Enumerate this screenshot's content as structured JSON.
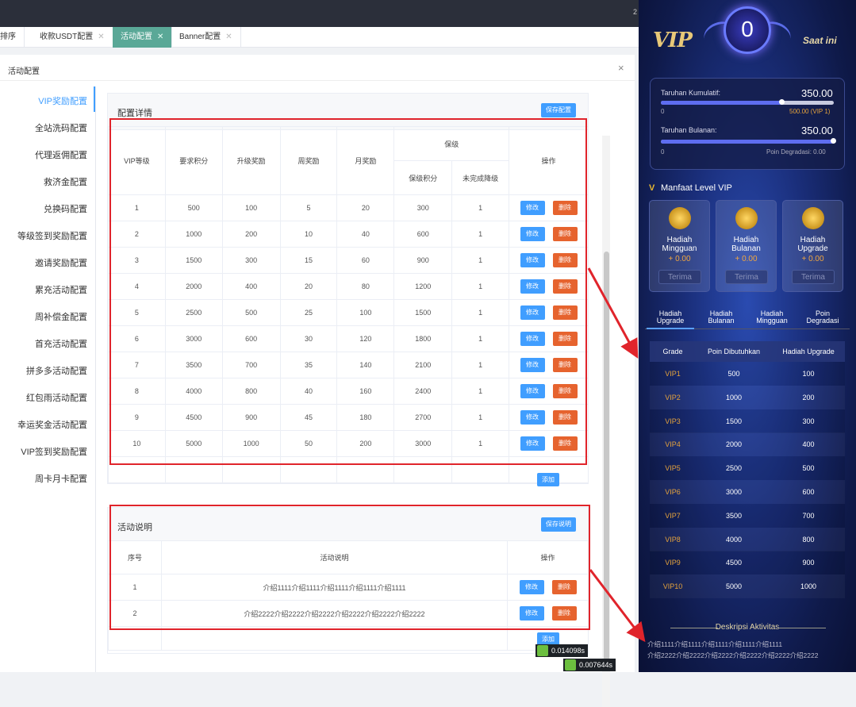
{
  "tabs": [
    {
      "label": "排序",
      "active": false
    },
    {
      "label": "收款USDT配置",
      "active": false
    },
    {
      "label": "活动配置",
      "active": true
    },
    {
      "label": "Banner配置",
      "active": false
    }
  ],
  "top_number": "2",
  "dialog": {
    "title": "活动配置",
    "close": "×"
  },
  "menu": [
    "VIP奖励配置",
    "全站洗码配置",
    "代理返佣配置",
    "救济金配置",
    "兑换码配置",
    "等级签到奖励配置",
    "邀请奖励配置",
    "累充活动配置",
    "周补偿金配置",
    "首充活动配置",
    "拼多多活动配置",
    "红包雨活动配置",
    "幸运奖金活动配置",
    "VIP签到奖励配置",
    "周卡月卡配置"
  ],
  "config_panel": {
    "title": "配置详情",
    "save_label": "保存配置",
    "headers": {
      "vip": "VIP等级",
      "points": "要求积分",
      "upgrade": "升级奖励",
      "weekly": "周奖励",
      "monthly": "月奖励",
      "keep": "保级",
      "keep_points": "保级积分",
      "not_done": "未完成降级",
      "ops": "操作"
    },
    "rows": [
      [
        "1",
        "500",
        "100",
        "5",
        "20",
        "300",
        "1"
      ],
      [
        "2",
        "1000",
        "200",
        "10",
        "40",
        "600",
        "1"
      ],
      [
        "3",
        "1500",
        "300",
        "15",
        "60",
        "900",
        "1"
      ],
      [
        "4",
        "2000",
        "400",
        "20",
        "80",
        "1200",
        "1"
      ],
      [
        "5",
        "2500",
        "500",
        "25",
        "100",
        "1500",
        "1"
      ],
      [
        "6",
        "3000",
        "600",
        "30",
        "120",
        "1800",
        "1"
      ],
      [
        "7",
        "3500",
        "700",
        "35",
        "140",
        "2100",
        "1"
      ],
      [
        "8",
        "4000",
        "800",
        "40",
        "160",
        "2400",
        "1"
      ],
      [
        "9",
        "4500",
        "900",
        "45",
        "180",
        "2700",
        "1"
      ],
      [
        "10",
        "5000",
        "1000",
        "50",
        "200",
        "3000",
        "1"
      ]
    ],
    "edit_label": "修改",
    "delete_label": "删除",
    "add_label": "添加"
  },
  "desc_panel": {
    "title": "活动说明",
    "save_label": "保存说明",
    "headers": {
      "no": "序号",
      "desc": "活动说明",
      "ops": "操作"
    },
    "rows": [
      [
        "1",
        "介绍1111介绍1111介绍1111介绍1111介绍1111"
      ],
      [
        "2",
        "介绍2222介绍2222介绍2222介绍2222介绍2222介绍2222"
      ]
    ],
    "edit_label": "修改",
    "delete_label": "删除",
    "add_label": "添加"
  },
  "timings": [
    "0.014098s",
    "0.007644s"
  ],
  "phone": {
    "vip_logo": "VIP",
    "vip_level": "0",
    "saat_ini": "Saat ini",
    "kumulatif_label": "Taruhan Kumulatif:",
    "kumulatif_value": "350.00",
    "kumulatif_progress": 0.7,
    "kumulatif_min": "0",
    "kumulatif_target": "500.00 (VIP 1)",
    "bulanan_label": "Taruhan Bulanan:",
    "bulanan_value": "350.00",
    "bulanan_progress": 1.0,
    "bulanan_min": "0",
    "bulanan_degradasi": "Poin Degradasi: 0.00",
    "manfaat_title": "Manfaat Level VIP",
    "benefits": [
      {
        "title1": "Hadiah",
        "title2": "Mingguan",
        "value": "+ 0.00",
        "button": "Terima"
      },
      {
        "title1": "Hadiah",
        "title2": "Bulanan",
        "value": "+ 0.00",
        "button": "Terima"
      },
      {
        "title1": "Hadiah",
        "title2": "Upgrade",
        "value": "+ 0.00",
        "button": "Terima"
      }
    ],
    "tabs": [
      {
        "l1": "Hadiah",
        "l2": "Upgrade"
      },
      {
        "l1": "Hadiah",
        "l2": "Bulanan"
      },
      {
        "l1": "Hadiah",
        "l2": "Mingguan"
      },
      {
        "l1": "Poin",
        "l2": "Degradasi"
      }
    ],
    "grade_headers": [
      "Grade",
      "Poin Dibutuhkan",
      "Hadiah Upgrade"
    ],
    "grades": [
      [
        "VIP1",
        "500",
        "100"
      ],
      [
        "VIP2",
        "1000",
        "200"
      ],
      [
        "VIP3",
        "1500",
        "300"
      ],
      [
        "VIP4",
        "2000",
        "400"
      ],
      [
        "VIP5",
        "2500",
        "500"
      ],
      [
        "VIP6",
        "3000",
        "600"
      ],
      [
        "VIP7",
        "3500",
        "700"
      ],
      [
        "VIP8",
        "4000",
        "800"
      ],
      [
        "VIP9",
        "4500",
        "900"
      ],
      [
        "VIP10",
        "5000",
        "1000"
      ]
    ],
    "deskripsi_title": "Deskripsi Aktivitas",
    "deskripsi_lines": [
      "介绍1111介绍1111介绍1111介绍1111介绍1111",
      "介绍2222介绍2222介绍2222介绍2222介绍2222介绍2222"
    ]
  },
  "colors": {
    "primary": "#409eff",
    "danger": "#e6632e",
    "highlight": "#e0242b",
    "active_tab": "#5aa897"
  }
}
